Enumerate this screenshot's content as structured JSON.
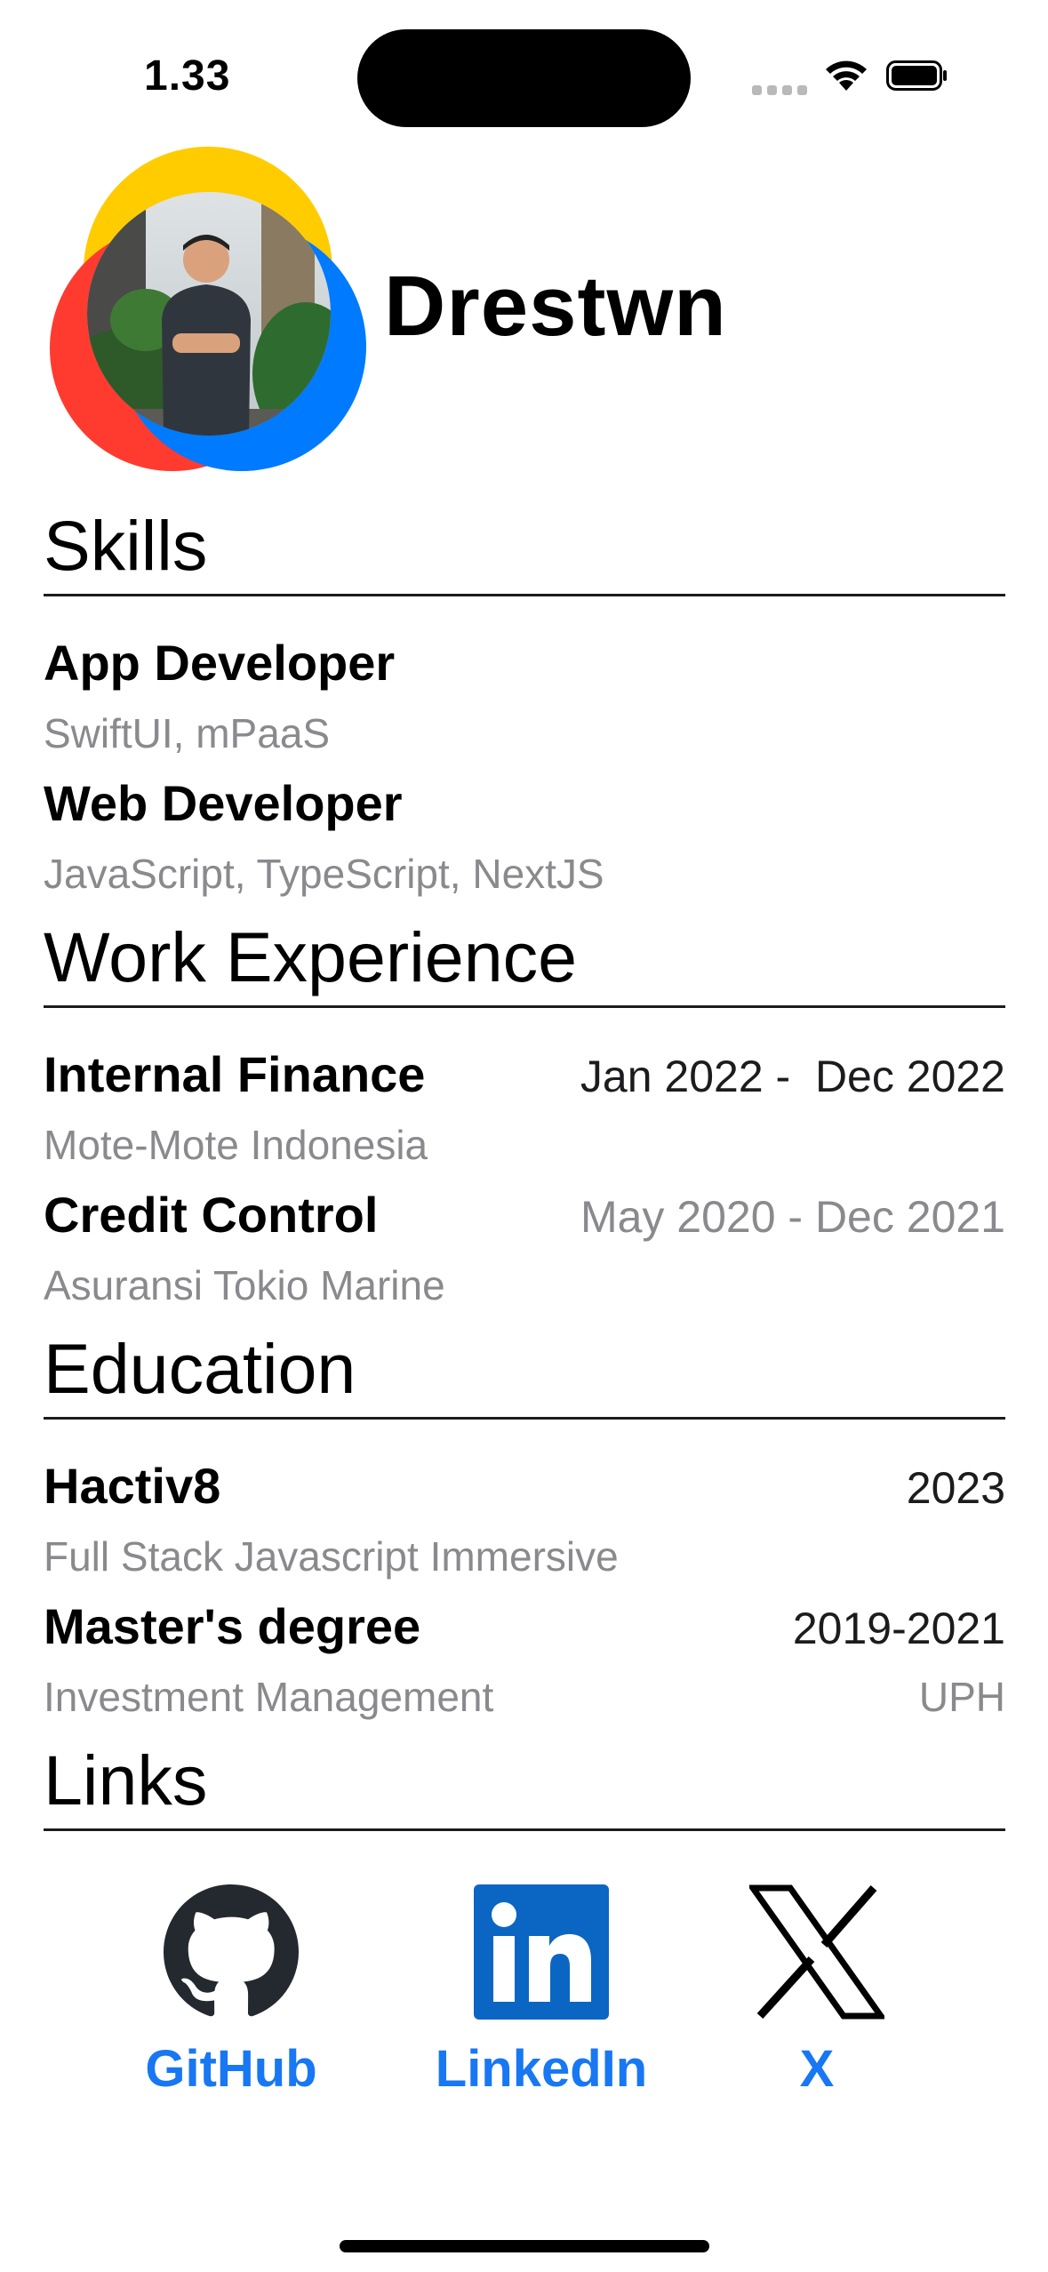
{
  "status_bar": {
    "time": "1.33"
  },
  "profile": {
    "name": "Drestwn"
  },
  "skills": {
    "title": "Skills",
    "items": [
      {
        "title": "App Developer",
        "subtitle": "SwiftUI, mPaaS"
      },
      {
        "title": "Web Developer",
        "subtitle": "JavaScript, TypeScript, NextJS"
      }
    ]
  },
  "work": {
    "title": "Work Experience",
    "items": [
      {
        "title": "Internal Finance",
        "period": "Jan 2022 -  Dec 2022",
        "company": "Mote-Mote Indonesia"
      },
      {
        "title": "Credit Control",
        "period": "May 2020 - Dec 2021",
        "company": "Asuransi Tokio Marine"
      }
    ]
  },
  "education": {
    "title": "Education",
    "items": [
      {
        "title": "Hactiv8",
        "year": "2023",
        "subtitle": "Full Stack Javascript Immersive",
        "institution": ""
      },
      {
        "title": "Master's degree",
        "year": "2019-2021",
        "subtitle": "Investment Management",
        "institution": "UPH"
      }
    ]
  },
  "links": {
    "title": "Links",
    "items": [
      {
        "label": "GitHub",
        "icon": "github-icon"
      },
      {
        "label": "LinkedIn",
        "icon": "linkedin-icon"
      },
      {
        "label": "X",
        "icon": "x-icon"
      }
    ]
  },
  "colors": {
    "accent": "#1877f2",
    "secondary_text": "#8a8a8e",
    "ring_yellow": "#ffcc00",
    "ring_red": "#ff3b30",
    "ring_blue": "#007aff"
  }
}
